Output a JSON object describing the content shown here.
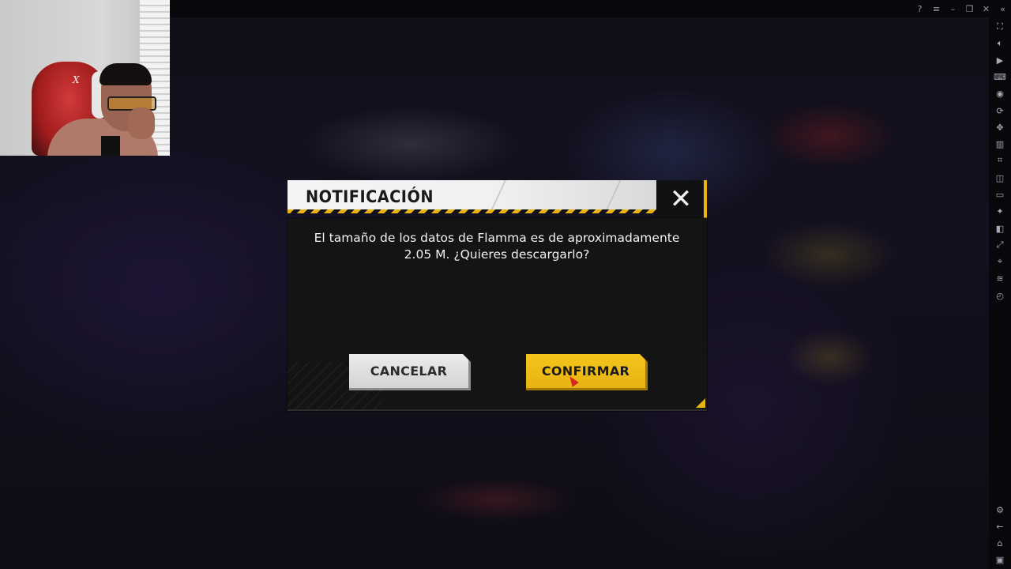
{
  "dialog": {
    "title": "NOTIFICACIÓN",
    "message": "El tamaño de los datos de Flamma es de aproximadamente 2.05 M. ¿Quieres descargarlo?",
    "cancel_label": "CANCELAR",
    "confirm_label": "CONFIRMAR",
    "close_icon": "close-icon"
  },
  "colors": {
    "accent": "#e9b313",
    "dialog_bg": "#141414",
    "header_bg": "#f1f1f1"
  },
  "window_controls": [
    {
      "name": "help-icon",
      "glyph": "?"
    },
    {
      "name": "menu-icon",
      "glyph": "≡"
    },
    {
      "name": "minimize-icon",
      "glyph": "–"
    },
    {
      "name": "restore-icon",
      "glyph": "❐"
    },
    {
      "name": "close-window-icon",
      "glyph": "✕"
    },
    {
      "name": "collapse-sidebar-icon",
      "glyph": "«"
    }
  ],
  "sidebar_icons": [
    "fullscreen-icon",
    "volume-icon",
    "video-icon",
    "keyboard-icon",
    "play-icon",
    "sync-icon",
    "gamepad-icon",
    "performance-icon",
    "screenshot-icon",
    "record-icon",
    "folder-icon",
    "install-icon",
    "multi-instance-icon",
    "rotate-icon",
    "location-icon",
    "layers-icon",
    "macro-icon"
  ],
  "sidebar_bottom_icons": [
    "settings-icon",
    "back-icon",
    "home-icon",
    "recent-apps-icon"
  ],
  "webcam": {
    "chair_logo": "X"
  }
}
